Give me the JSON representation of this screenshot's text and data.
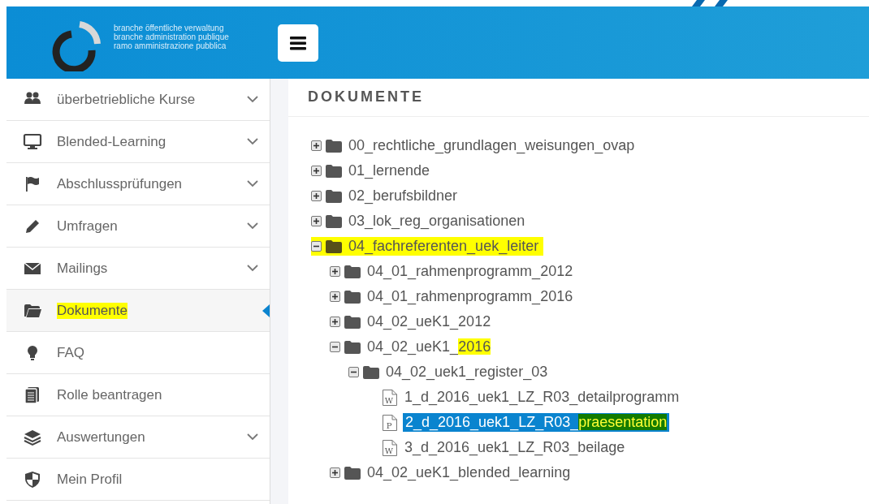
{
  "header": {
    "brand_lines": [
      "branche öffentliche verwaltung",
      "branche administration publique",
      "ramo amministrazione pubblica"
    ]
  },
  "sidebar": {
    "items": [
      {
        "label": "überbetriebliche Kurse",
        "has_submenu": true,
        "selected": false,
        "highlighted": false
      },
      {
        "label": "Blended-Learning",
        "has_submenu": true,
        "selected": false,
        "highlighted": false
      },
      {
        "label": "Abschlussprüfungen",
        "has_submenu": true,
        "selected": false,
        "highlighted": false
      },
      {
        "label": "Umfragen",
        "has_submenu": true,
        "selected": false,
        "highlighted": false
      },
      {
        "label": "Mailings",
        "has_submenu": true,
        "selected": false,
        "highlighted": false
      },
      {
        "label": "Dokumente",
        "has_submenu": false,
        "selected": true,
        "highlighted": true
      },
      {
        "label": "FAQ",
        "has_submenu": false,
        "selected": false,
        "highlighted": false
      },
      {
        "label": "Rolle beantragen",
        "has_submenu": false,
        "selected": false,
        "highlighted": false
      },
      {
        "label": "Auswertungen",
        "has_submenu": true,
        "selected": false,
        "highlighted": false
      },
      {
        "label": "Mein Profil",
        "has_submenu": false,
        "selected": false,
        "highlighted": false
      }
    ]
  },
  "main": {
    "title": "DOKUMENTE",
    "tree": [
      {
        "kind": "folder",
        "expanded": false,
        "selected": false,
        "parts": [
          {
            "text": "00_rechtliche_grundlagen_weisungen_ovap",
            "highlighted": false
          }
        ]
      },
      {
        "kind": "folder",
        "expanded": false,
        "selected": false,
        "parts": [
          {
            "text": "01_lernende",
            "highlighted": false
          }
        ]
      },
      {
        "kind": "folder",
        "expanded": false,
        "selected": false,
        "parts": [
          {
            "text": "02_berufsbildner",
            "highlighted": false
          }
        ]
      },
      {
        "kind": "folder",
        "expanded": false,
        "selected": false,
        "parts": [
          {
            "text": "03_lok_reg_organisationen",
            "highlighted": false
          }
        ]
      },
      {
        "kind": "folder",
        "expanded": true,
        "selected": false,
        "parts": [
          {
            "text": "04_fachreferenten_uek_leiter",
            "highlighted": true
          }
        ],
        "children": [
          {
            "kind": "folder",
            "expanded": false,
            "selected": false,
            "parts": [
              {
                "text": "04_01_rahmenprogramm_2012",
                "highlighted": false
              }
            ]
          },
          {
            "kind": "folder",
            "expanded": false,
            "selected": false,
            "parts": [
              {
                "text": "04_01_rahmenprogramm_2016",
                "highlighted": false
              }
            ]
          },
          {
            "kind": "folder",
            "expanded": false,
            "selected": false,
            "parts": [
              {
                "text": "04_02_ueK1_2012",
                "highlighted": false
              }
            ]
          },
          {
            "kind": "folder",
            "expanded": true,
            "selected": false,
            "parts": [
              {
                "text": "04_02_ueK1_",
                "highlighted": false
              },
              {
                "text": "2016",
                "highlighted": true
              }
            ],
            "children": [
              {
                "kind": "folder",
                "expanded": true,
                "selected": false,
                "parts": [
                  {
                    "text": "04_02_uek1_register_03",
                    "highlighted": false
                  }
                ],
                "children": [
                  {
                    "kind": "file",
                    "badge": "W",
                    "selected": false,
                    "parts": [
                      {
                        "text": "1_d_2016_uek1_LZ_R03_detailprogramm",
                        "highlighted": false
                      }
                    ]
                  },
                  {
                    "kind": "file",
                    "badge": "P",
                    "selected": true,
                    "parts": [
                      {
                        "text": "2_d_2016_uek1_LZ_R03_",
                        "highlighted": false
                      },
                      {
                        "text": "praesentation",
                        "highlighted": true
                      }
                    ]
                  },
                  {
                    "kind": "file",
                    "badge": "W",
                    "selected": false,
                    "parts": [
                      {
                        "text": "3_d_2016_uek1_LZ_R03_beilage",
                        "highlighted": false
                      }
                    ]
                  }
                ]
              }
            ]
          },
          {
            "kind": "folder",
            "expanded": false,
            "selected": false,
            "parts": [
              {
                "text": "04_02_ueK1_blended_learning",
                "highlighted": false
              }
            ]
          }
        ]
      }
    ]
  }
}
